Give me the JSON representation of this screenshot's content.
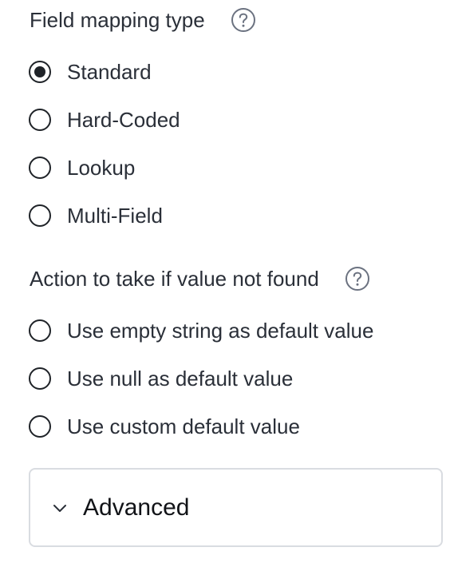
{
  "field_mapping": {
    "title": "Field mapping type",
    "options": [
      {
        "label": "Standard",
        "selected": true
      },
      {
        "label": "Hard-Coded",
        "selected": false
      },
      {
        "label": "Lookup",
        "selected": false
      },
      {
        "label": "Multi-Field",
        "selected": false
      }
    ]
  },
  "not_found_action": {
    "title": "Action to take if value not found",
    "options": [
      {
        "label": "Use empty string as default value",
        "selected": false
      },
      {
        "label": "Use null as default value",
        "selected": false
      },
      {
        "label": "Use custom default value",
        "selected": false
      }
    ]
  },
  "advanced": {
    "label": "Advanced",
    "expanded": false
  },
  "icons": {
    "help": "help-circle-icon",
    "chevron": "chevron-down-icon"
  },
  "colors": {
    "text": "#2a2f38",
    "radio_border": "#1f2328",
    "panel_border": "#d9dce1"
  }
}
